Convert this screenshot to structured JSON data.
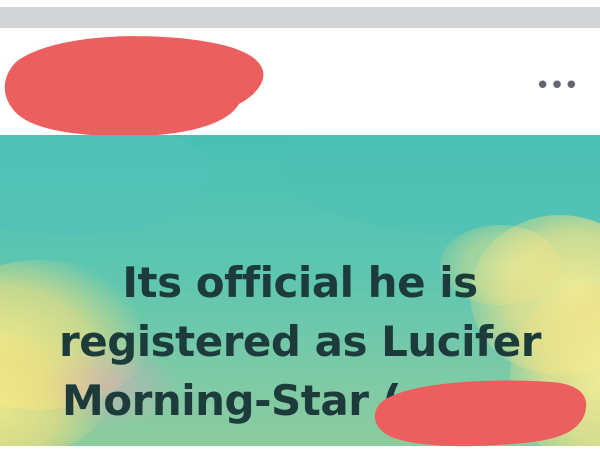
{
  "header": {
    "more_label": "•••"
  },
  "post": {
    "lines": [
      "Its official he is",
      "registered as Lucifer",
      "Morning-Star ("
    ],
    "text_color": "#1c3b3a"
  },
  "colors": {
    "redaction": "#ec5f5f",
    "background_teal": "#4fc3b3",
    "cloud_yellow": "#f3e37a"
  },
  "icons": {
    "more": "more-horizontal-icon"
  }
}
